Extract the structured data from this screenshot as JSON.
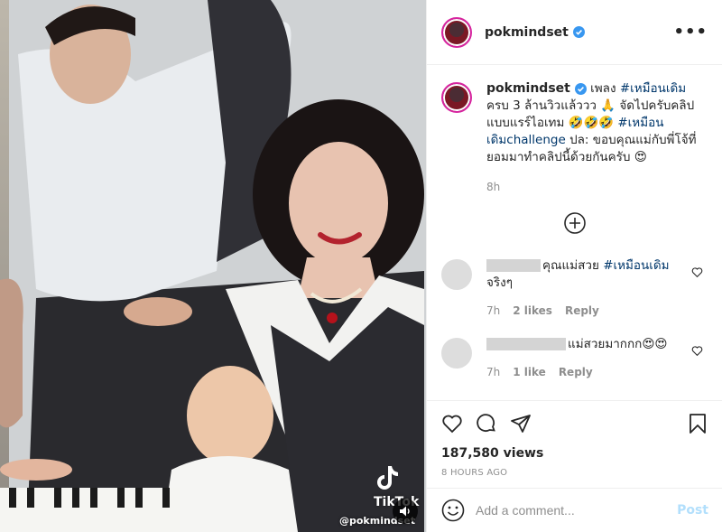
{
  "media": {
    "tiktok_wordmark": "TikTok",
    "tiktok_handle": "@pokmindset"
  },
  "header": {
    "username": "pokmindset",
    "more_label": "•••"
  },
  "caption": {
    "username": "pokmindset",
    "text_1": "เพลง ",
    "hashtag_1": "#เหมือนเดิม",
    "text_2": " ครบ 3 ล้านวิวแล้ววว 🙏 จัดไปครับคลิปแบบแรร์ไอเทม 🤣🤣🤣 ",
    "hashtag_2": "#เหมือนเดิมchallenge",
    "text_3": " ปล: ขอบคุณแม่กับพี่โจ้ที่ยอมมาทำคลิปนี้ด้วยกันครับ 😍",
    "time": "8h"
  },
  "comments": [
    {
      "text": "คุณแม่สวย ",
      "hashtag": "#เหมือนเดิม",
      "text_after": " จริงๆ",
      "time": "7h",
      "likes": "2 likes",
      "reply": "Reply"
    },
    {
      "text": "แม่สวยมากกก😍😍",
      "time": "7h",
      "likes": "1 like",
      "reply": "Reply"
    }
  ],
  "stats": {
    "views": "187,580 views",
    "time_ago": "8 HOURS AGO"
  },
  "add_comment": {
    "placeholder": "Add a comment...",
    "post_label": "Post"
  },
  "colors": {
    "link": "#00376b",
    "post_disabled": "#b2dffc",
    "verified": "#3897f0"
  }
}
